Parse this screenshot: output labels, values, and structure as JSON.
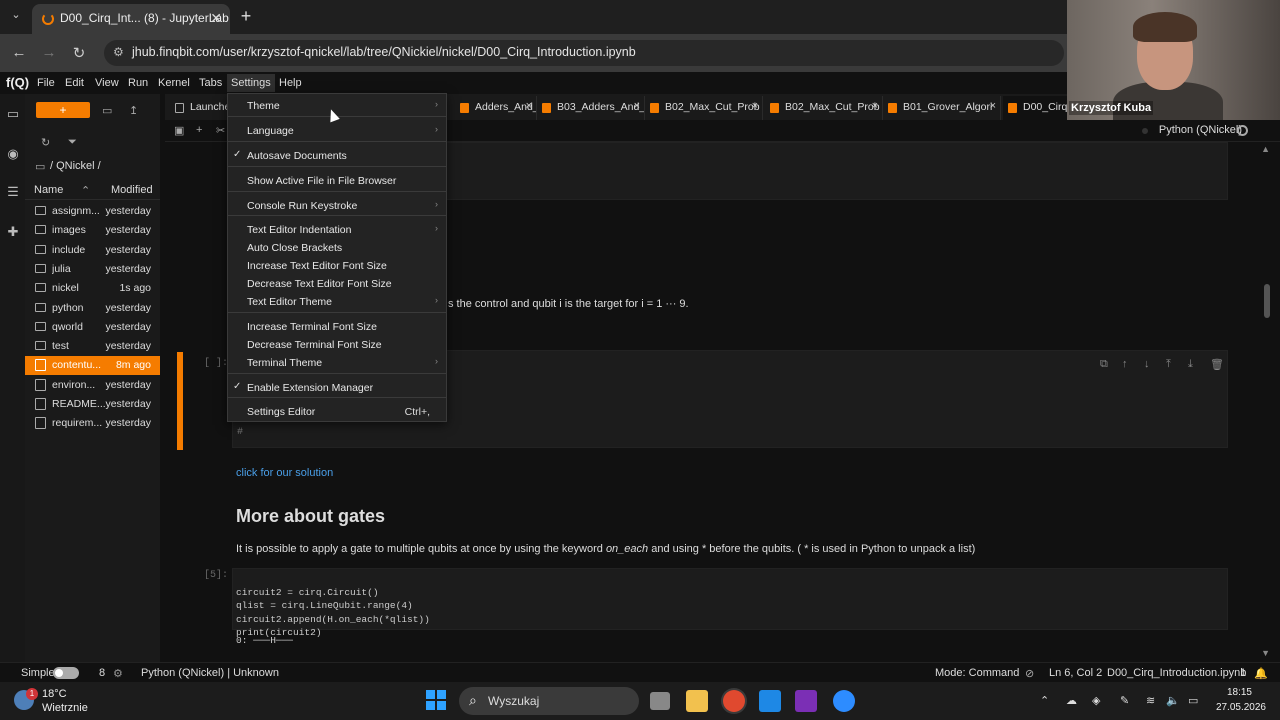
{
  "browser": {
    "tab_title": "D00_Cirq_Int... (8) - JupyterLab",
    "tab_close": "✕",
    "new_tab": "+",
    "url": "jhub.finqbit.com/user/krzysztof-qnickel/lab/tree/QNickiel/nickel/D00_Cirq_Introduction.ipynb"
  },
  "jupyter": {
    "logo": "f(Q)",
    "menus": [
      "File",
      "Edit",
      "View",
      "Run",
      "Kernel",
      "Tabs",
      "Settings",
      "Help"
    ],
    "new_launcher": "+",
    "breadcrumb": "/ QNickel /",
    "file_header": {
      "name": "Name",
      "modified": "Modified"
    },
    "files": [
      {
        "name": "assignm...",
        "modified": "yesterday",
        "type": "folder"
      },
      {
        "name": "images",
        "modified": "yesterday",
        "type": "folder"
      },
      {
        "name": "include",
        "modified": "yesterday",
        "type": "folder"
      },
      {
        "name": "julia",
        "modified": "yesterday",
        "type": "folder"
      },
      {
        "name": "nickel",
        "modified": "1s ago",
        "type": "folder"
      },
      {
        "name": "python",
        "modified": "yesterday",
        "type": "folder"
      },
      {
        "name": "qworld",
        "modified": "yesterday",
        "type": "folder"
      },
      {
        "name": "test",
        "modified": "yesterday",
        "type": "folder"
      },
      {
        "name": "contentu...",
        "modified": "8m ago",
        "type": "notebook"
      },
      {
        "name": "environ...",
        "modified": "yesterday",
        "type": "file"
      },
      {
        "name": "README...",
        "modified": "yesterday",
        "type": "file"
      },
      {
        "name": "requirem...",
        "modified": "yesterday",
        "type": "file"
      }
    ],
    "doc_tabs": [
      {
        "label": "Launcher"
      },
      {
        "label": "Adders_And_N"
      },
      {
        "label": "B03_Adders_And_N"
      },
      {
        "label": "B02_Max_Cut_Prob"
      },
      {
        "label": "B02_Max_Cut_Prob"
      },
      {
        "label": "B01_Grover_Algori"
      },
      {
        "label": "D00_Cirq_In"
      }
    ],
    "kernel": "Python (QNickel)",
    "cells": {
      "partial_text": "s the control and qubit i is the target for i = 1 ··· 9.",
      "prompt_empty": "[ ]:",
      "hash": "#",
      "solution_link": "click for our solution",
      "heading": "More about gates",
      "paragraph_a": "It is possible to apply a gate to multiple qubits at once by using the keyword ",
      "paragraph_em": "on_each",
      "paragraph_b": " and using  *  before the qubits. ( *  is used in Python to unpack a list)",
      "prompt_5": "[5]:",
      "code_lines": [
        "circuit2 = cirq.Circuit()",
        "qlist = cirq.LineQubit.range(4)",
        "circuit2.append(H.on_each(*qlist))",
        "print(circuit2)"
      ],
      "output": "0: ───H───"
    },
    "settings_menu": [
      {
        "label": "Theme",
        "submenu": true
      },
      {
        "label": "Language",
        "submenu": true
      },
      {
        "label": "Autosave Documents",
        "checked": true
      },
      {
        "label": "Show Active File in File Browser"
      },
      {
        "label": "Console Run Keystroke",
        "submenu": true
      },
      {
        "label": "Text Editor Indentation",
        "submenu": true
      },
      {
        "label": "Auto Close Brackets"
      },
      {
        "label": "Increase Text Editor Font Size"
      },
      {
        "label": "Decrease Text Editor Font Size"
      },
      {
        "label": "Text Editor Theme",
        "submenu": true
      },
      {
        "label": "Increase Terminal Font Size"
      },
      {
        "label": "Decrease Terminal Font Size"
      },
      {
        "label": "Terminal Theme",
        "submenu": true
      },
      {
        "label": "Enable Extension Manager",
        "checked": true
      },
      {
        "label": "Settings Editor",
        "shortcut": "Ctrl+,"
      }
    ],
    "status": {
      "mode_label": "Simple",
      "count": "8",
      "kernel_status": "Python (QNickel) | Unknown",
      "mode": "Mode: Command",
      "position": "Ln 6, Col 2",
      "filename": "D00_Cirq_Introduction.ipynb",
      "right_count": "1"
    }
  },
  "video": {
    "name": "Krzysztof Kuba"
  },
  "taskbar": {
    "temp": "18°C",
    "weather": "Wietrznie",
    "badge": "1",
    "search": "Wyszukaj",
    "time": "18:15",
    "date": "27.05.2026"
  }
}
